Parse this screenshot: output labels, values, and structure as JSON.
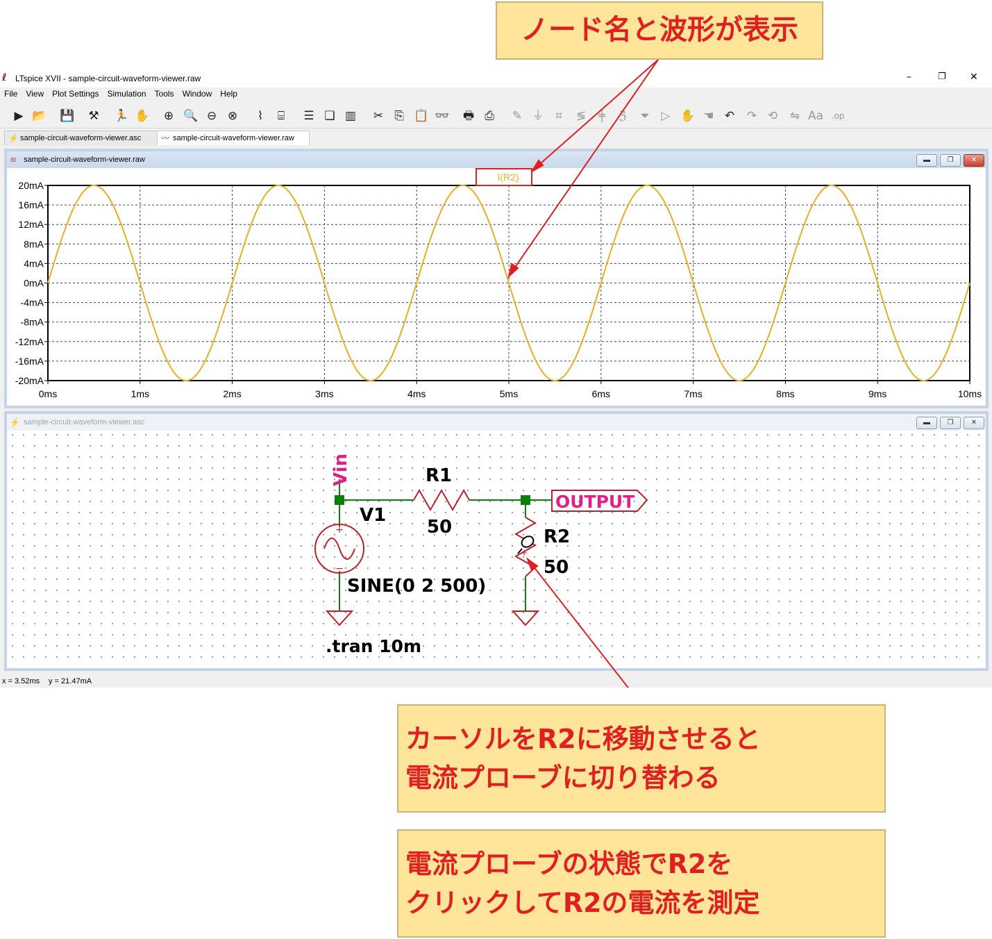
{
  "window": {
    "title": "LTspice XVII - sample-circuit-waveform-viewer.raw",
    "minimize": "–",
    "restore": "❐",
    "close": "✕"
  },
  "menu": [
    "File",
    "View",
    "Plot Settings",
    "Simulation",
    "Tools",
    "Window",
    "Help"
  ],
  "toolbar_icons": [
    "run-icon",
    "open-icon",
    "save-icon",
    "control-panel-icon",
    "halt-icon",
    "pan-icon",
    "zoom-in-icon",
    "zoom-area-icon",
    "zoom-out-icon",
    "zoom-fit-icon",
    "autorange-icon",
    "autorange-y-icon",
    "tile-horizontal-icon",
    "cascade-icon",
    "tile-vertical-icon",
    "cut-icon",
    "copy-icon",
    "paste-icon",
    "find-icon",
    "print-icon",
    "print-preview-icon",
    "wire-icon",
    "ground-icon",
    "label-icon",
    "resistor-icon",
    "capacitor-icon",
    "inductor-icon",
    "diode-icon",
    "component-icon",
    "move-icon",
    "drag-icon",
    "undo-icon",
    "redo-icon",
    "rotate-icon",
    "mirror-icon",
    "text-icon",
    "spice-directive-icon"
  ],
  "tabs": [
    {
      "label": "sample-circuit-waveform-viewer.asc",
      "icon": "schematic-icon",
      "active": false
    },
    {
      "label": "sample-circuit-waveform-viewer.raw",
      "icon": "waveform-icon",
      "active": true
    }
  ],
  "waveform_window": {
    "title": "sample-circuit-waveform-viewer.raw"
  },
  "schematic_window": {
    "title": "sample-circuit-waveform-viewer.asc"
  },
  "chart_data": {
    "type": "line",
    "title": "I(R2)",
    "series": [
      {
        "name": "I(R2)",
        "function": "20*sin(2*pi*500*t)",
        "amplitude": 20,
        "frequency_hz": 500,
        "color": "#e8b020"
      }
    ],
    "x_ticks": [
      "0ms",
      "1ms",
      "2ms",
      "3ms",
      "4ms",
      "5ms",
      "6ms",
      "7ms",
      "8ms",
      "9ms",
      "10ms"
    ],
    "y_ticks": [
      "20mA",
      "16mA",
      "12mA",
      "8mA",
      "4mA",
      "0mA",
      "-4mA",
      "-8mA",
      "-12mA",
      "-16mA",
      "-20mA"
    ],
    "xlim": [
      0,
      10
    ],
    "ylim": [
      -20,
      20
    ],
    "grid": true
  },
  "schematic": {
    "vin_label": "Vin",
    "r1_name": "R1",
    "r1_value": "50",
    "v1_name": "V1",
    "v1_value": "SINE(0 2 500)",
    "output_label": "OUTPUT",
    "r2_name": "R2",
    "r2_value": "50",
    "tran": ".tran 10m",
    "plus": "+",
    "minus": "−"
  },
  "status": {
    "x": "x = 3.52ms",
    "y": "y = 21.47mA"
  },
  "callouts": {
    "top": "ノード名と波形が表示",
    "middle_line1": "カーソルをR2に移動させると",
    "middle_line2": "電流プローブに切り替わる",
    "bottom_line1": "電流プローブの状態でR2を",
    "bottom_line2": "クリックしてR2の電流を測定"
  },
  "colors": {
    "trace": "#e8b020",
    "wire": "#0a7f0a",
    "component": "#c0202a",
    "net_label": "#e0208a",
    "annotation": "#e02020",
    "callout_bg": "#ffe599"
  }
}
